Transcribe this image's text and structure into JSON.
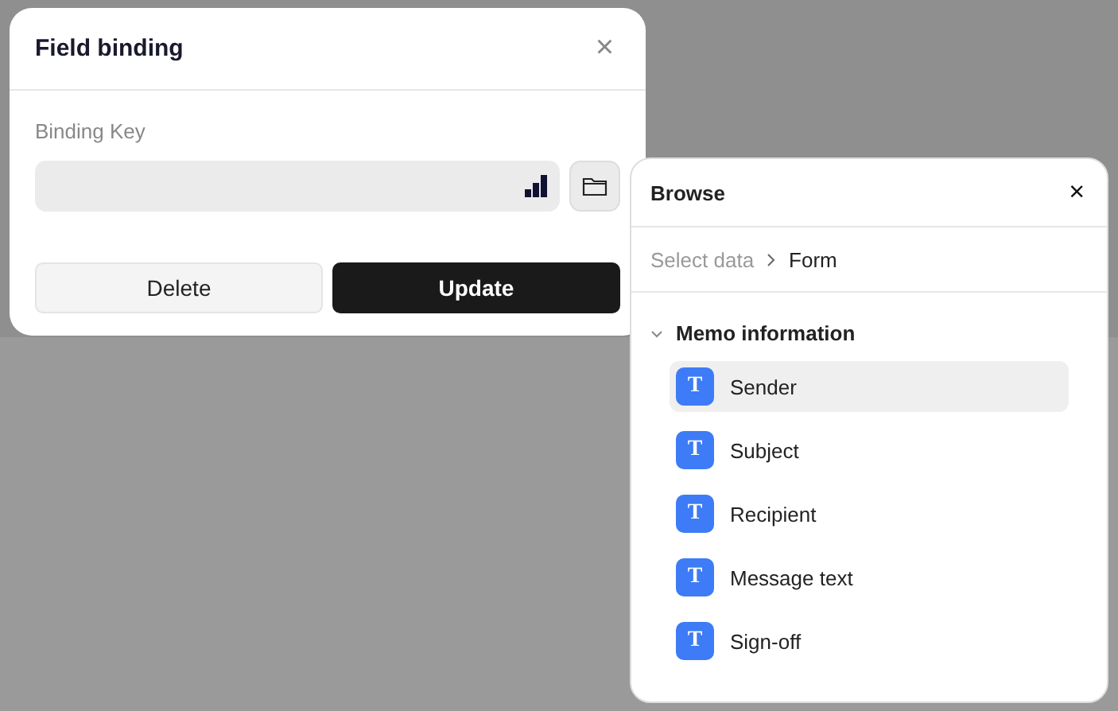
{
  "field_dialog": {
    "title": "Field binding",
    "close": "×",
    "label": "Binding Key",
    "buttons": [
      {
        "label": "Delete",
        "kind": "secondary"
      },
      {
        "label": "Update",
        "kind": "primary"
      }
    ]
  },
  "browse_panel": {
    "title": "Browse",
    "close": "×",
    "breadcrumb": [
      {
        "label": "Select data",
        "current": false
      },
      {
        "label": "Form",
        "current": true
      }
    ],
    "group": {
      "label": "Memo information",
      "expanded": true,
      "items": [
        {
          "label": "Sender",
          "icon": "T",
          "selected": true
        },
        {
          "label": "Subject",
          "icon": "T",
          "selected": false
        },
        {
          "label": "Recipient",
          "icon": "T",
          "selected": false
        },
        {
          "label": "Message text",
          "icon": "T",
          "selected": false
        },
        {
          "label": "Sign-off",
          "icon": "T",
          "selected": false
        }
      ]
    }
  }
}
